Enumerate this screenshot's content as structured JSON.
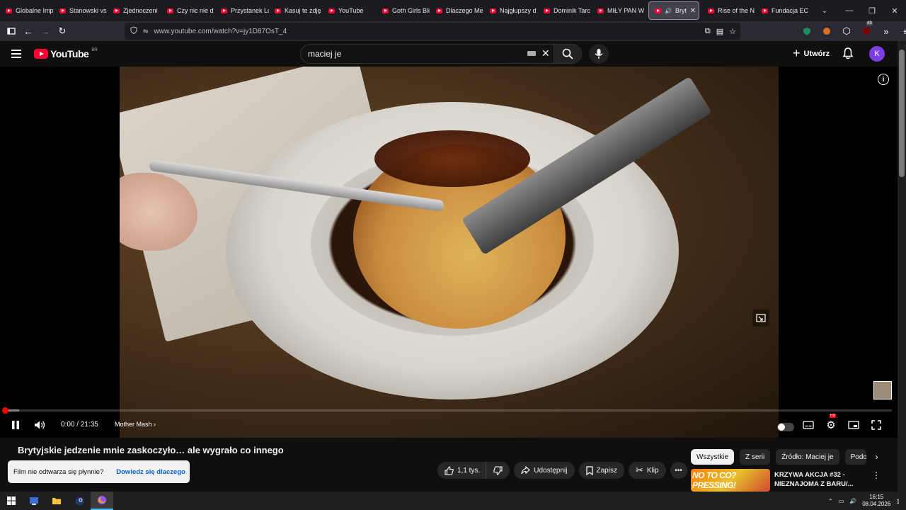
{
  "browser": {
    "tabs": [
      {
        "label": "Globalne Imp"
      },
      {
        "label": "Stanowski vs"
      },
      {
        "label": "Zjednoczeni"
      },
      {
        "label": "Czy nic nie d"
      },
      {
        "label": "Przystanek Lo"
      },
      {
        "label": "Kasuj te zdję"
      },
      {
        "label": "YouTube"
      },
      {
        "label": "Goth Girls Bli"
      },
      {
        "label": "Dlaczego Me"
      },
      {
        "label": "Najgłupszy d"
      },
      {
        "label": "Dominik Tarc"
      },
      {
        "label": "MIŁY PAN W"
      },
      {
        "label": "Brytyj"
      },
      {
        "label": "Rise of the N"
      },
      {
        "label": "Fundacja EC"
      }
    ],
    "url": "www.youtube.com/watch?v=jy1D87OsT_4",
    "badge_count": "43"
  },
  "youtube": {
    "logo_text": "YouTube",
    "country_code": "BR",
    "search_value": "maciej je",
    "create_label": "Utwórz",
    "avatar_letter": "K"
  },
  "player": {
    "time": "0:00 / 21:35",
    "chapter": "Mother Mash",
    "progress_fraction": 0.0,
    "buffered_fraction": 0.015
  },
  "video": {
    "title": "Brytyjskie jedzenie mnie zaskoczyło… ale wygrało co innego",
    "like_count": "1,1 tys.",
    "share_label": "Udostępnij",
    "save_label": "Zapisz",
    "clip_label": "Klip"
  },
  "toast": {
    "message": "Film nie odtwarza się płynnie?",
    "link": "Dowiedz się dlaczego"
  },
  "chips": [
    "Wszystkie",
    "Z serii",
    "Źródło: Maciej je",
    "Podo"
  ],
  "recommendation": {
    "thumb_text": "NO TO CO? PRESSING!",
    "title": "KRZYWA AKCJA #32 - NIEZNAJOMA Z BARU/..."
  },
  "taskbar": {
    "time": "16:15",
    "date": "08.04.2026"
  }
}
